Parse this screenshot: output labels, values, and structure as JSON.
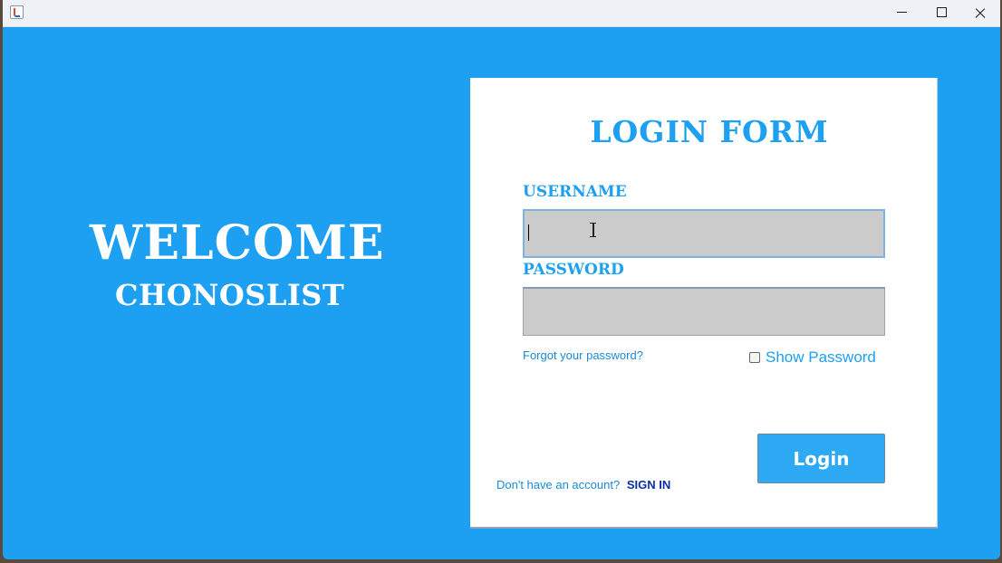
{
  "window": {
    "title": "",
    "controls": {
      "minimize_icon": "minimize-icon",
      "maximize_icon": "maximize-icon",
      "close_icon": "close-icon"
    }
  },
  "left_panel": {
    "welcome": "WELCOME",
    "app_name": "CHONOSLIST"
  },
  "form": {
    "title": "LOGIN FORM",
    "username_label": "USERNAME",
    "username_value": "",
    "password_label": "PASSWORD",
    "password_value": "",
    "forgot_password": "Forgot your password?",
    "show_password_label": "Show Password",
    "show_password_checked": false,
    "login_button": "Login",
    "no_account_text": "Don't have an account?",
    "sign_in_link": "SIGN IN"
  },
  "colors": {
    "background": "#1da0f2",
    "panel": "#ffffff",
    "accent": "#1da0f2",
    "input_bg": "#cbcbcb",
    "button": "#2eaaf5",
    "link_dark": "#0a2fa8"
  }
}
